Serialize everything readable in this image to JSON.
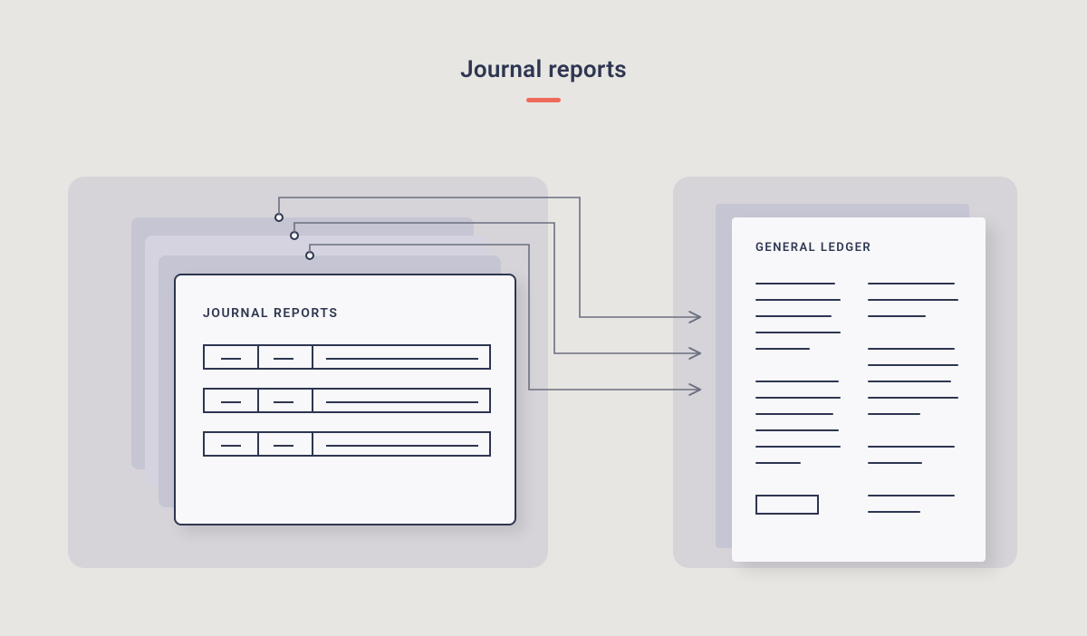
{
  "title": "Journal reports",
  "journal_card": {
    "label": "JOURNAL REPORTS"
  },
  "ledger_card": {
    "label": "GENERAL LEDGER"
  },
  "colors": {
    "background": "#e8e6e2",
    "panel": "#d6d4d9",
    "card_stack_dark": "#c6c5d3",
    "card_stack_light": "#d4d3df",
    "card_surface": "#f8f7f9",
    "ink": "#2d3651",
    "accent": "#ef6a5c"
  }
}
